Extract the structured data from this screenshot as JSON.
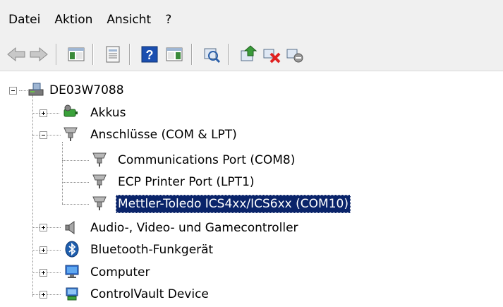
{
  "menu": {
    "items": [
      "Datei",
      "Aktion",
      "Ansicht",
      "?"
    ]
  },
  "toolbar": {
    "buttons": [
      "back-arrow-icon",
      "forward-arrow-icon",
      "show-hide-console-tree-icon",
      "properties-icon",
      "help-icon",
      "show-action-pane-icon",
      "scan-hardware-changes-icon",
      "update-driver-icon",
      "uninstall-device-icon",
      "disable-device-icon"
    ]
  },
  "tree": {
    "root": "DE03W7088",
    "categories": {
      "akkus": "Akkus",
      "anschluesse": "Anschlüsse (COM & LPT)",
      "audio": "Audio-, Video- und Gamecontroller",
      "bluetooth": "Bluetooth-Funkgerät",
      "computer": "Computer",
      "controlvault": "ControlVault Device"
    },
    "ports": {
      "comm": "Communications Port (COM8)",
      "ecp": "ECP Printer Port (LPT1)",
      "mettler": "Mettler-Toledo ICS4xx/ICS6xx (COM10)"
    },
    "selected": "Mettler-Toledo ICS4xx/ICS6xx (COM10)"
  },
  "colors": {
    "selection": "#0a246a",
    "chrome": "#f0f0f0"
  }
}
